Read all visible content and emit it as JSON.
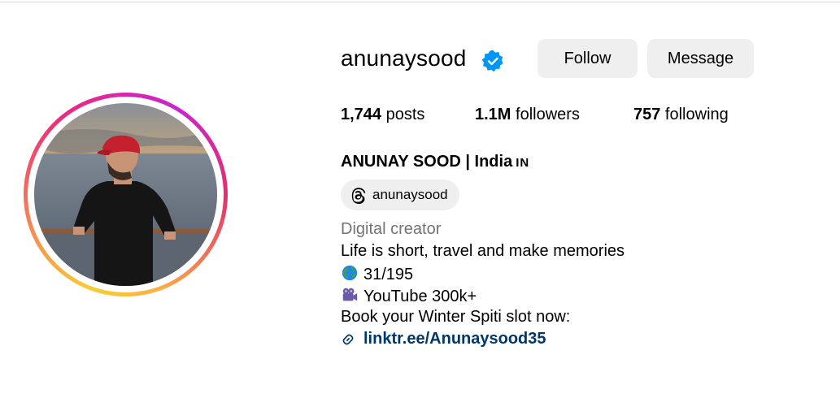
{
  "profile": {
    "username": "anunaysood",
    "verified": true,
    "follow_label": "Follow",
    "message_label": "Message",
    "stats": {
      "posts_count": "1,744",
      "posts_label": " posts",
      "followers_count": "1.1M",
      "followers_label": " followers",
      "following_count": "757",
      "following_label": " following"
    },
    "full_name": "ANUNAY SOOD | India",
    "full_name_flag": "IN",
    "threads_handle": "anunaysood",
    "category": "Digital creator",
    "bio_lines": [
      "Life is short, travel and make memories",
      "31/195",
      "YouTube 300k+",
      "Book your Winter Spiti slot now:"
    ],
    "link_text": "linktr.ee/Anunaysood35"
  },
  "colors": {
    "verified_blue": "#0095f6",
    "link_blue": "#00376b",
    "button_bg": "#efefef",
    "category_gray": "#737373"
  },
  "icons": [
    "verified-badge-icon",
    "threads-icon",
    "globe-emoji-icon",
    "video-camera-emoji-icon",
    "link-icon"
  ]
}
